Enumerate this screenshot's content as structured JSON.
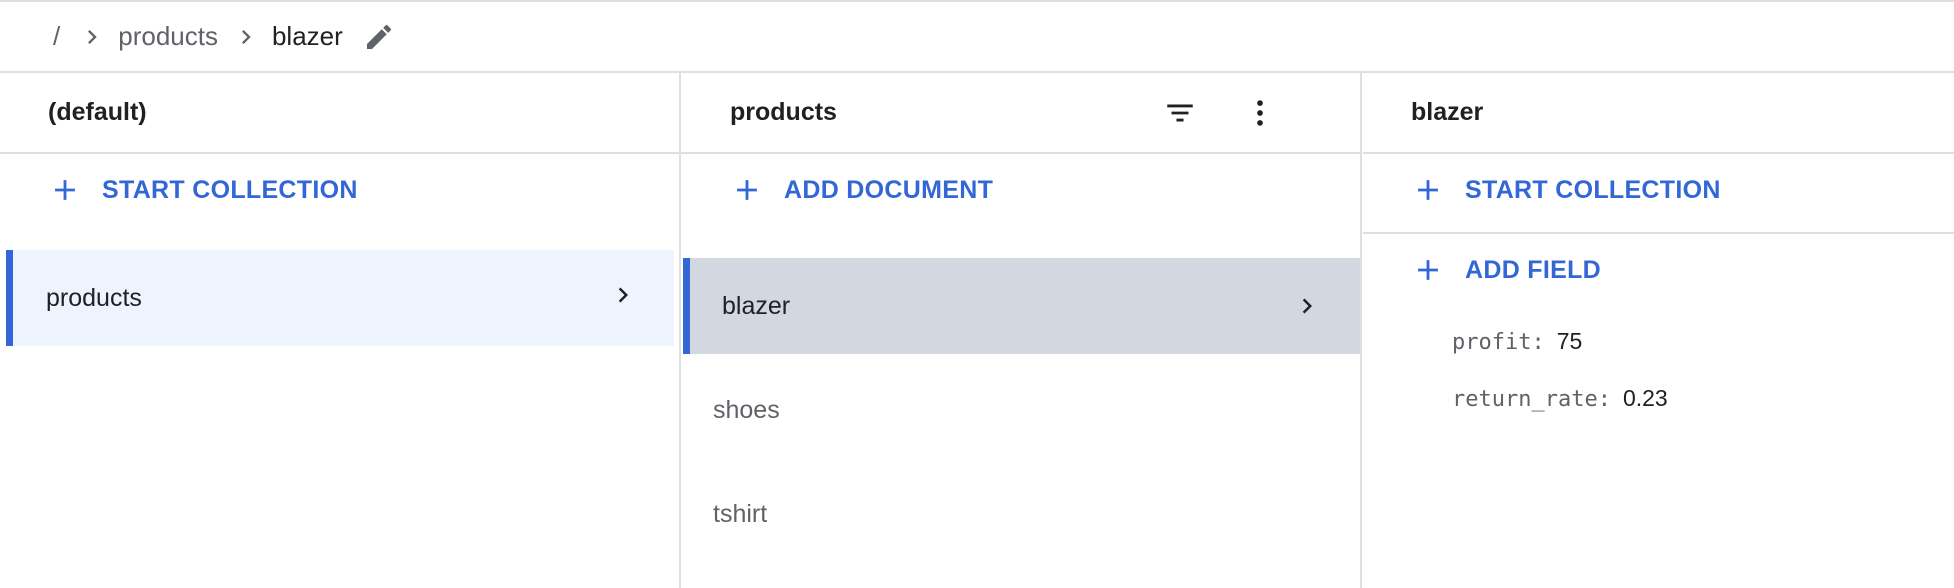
{
  "breadcrumb": {
    "root": "/",
    "items": [
      "products",
      "blazer"
    ]
  },
  "columns": {
    "database": {
      "title": "(default)",
      "start_collection": "START COLLECTION",
      "items": [
        {
          "label": "products",
          "selected": true
        }
      ]
    },
    "collection": {
      "title": "products",
      "add_document": "ADD DOCUMENT",
      "items": [
        {
          "label": "blazer",
          "selected": true
        },
        {
          "label": "shoes",
          "selected": false
        },
        {
          "label": "tshirt",
          "selected": false
        }
      ]
    },
    "document": {
      "title": "blazer",
      "start_collection": "START COLLECTION",
      "add_field": "ADD FIELD",
      "fields": [
        {
          "key": "profit:",
          "value": "75"
        },
        {
          "key": "return_rate:",
          "value": "0.23"
        }
      ]
    }
  },
  "colors": {
    "accent": "#3367d6",
    "selected_bg_light": "#eef4fe",
    "selected_bg_dark": "#d3d7df",
    "divider": "#e0e0e0"
  },
  "icons": {
    "breadcrumb_separator": "chevron-right-icon",
    "edit": "pencil-icon",
    "filter": "filter-icon",
    "more": "more-vert-icon",
    "add": "plus-icon",
    "navigate": "chevron-right-icon"
  }
}
